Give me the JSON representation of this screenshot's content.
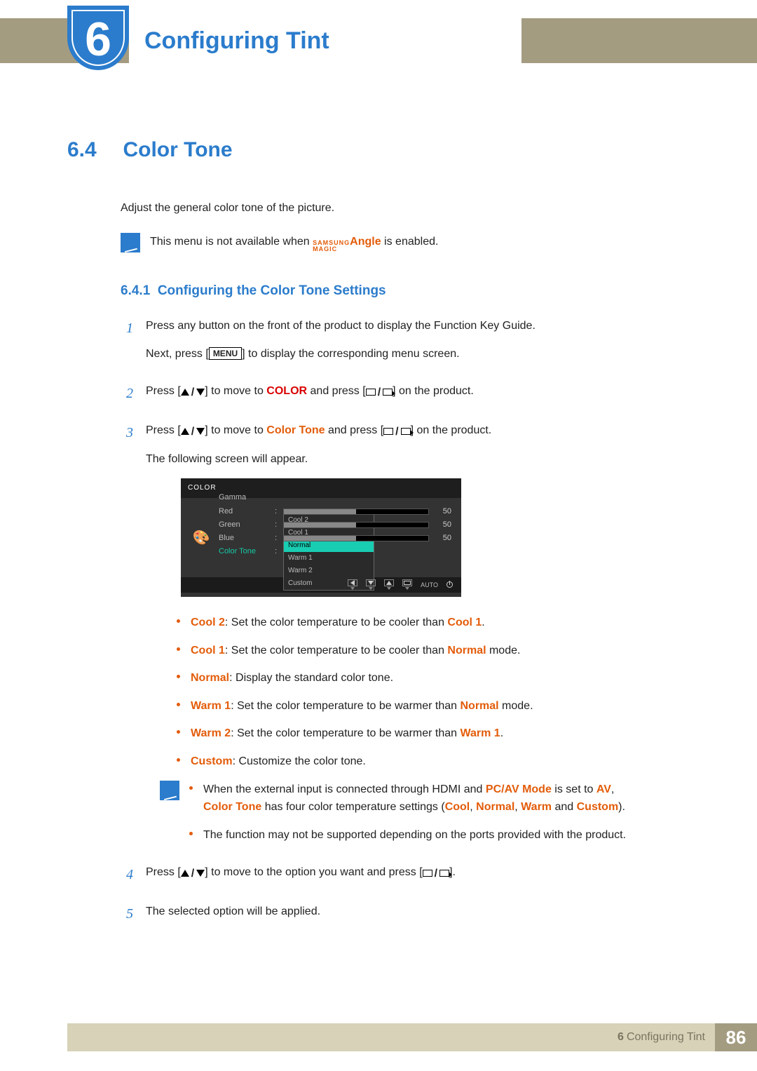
{
  "chapter": {
    "number": "6",
    "title": "Configuring Tint"
  },
  "section": {
    "number": "6.4",
    "title": "Color Tone",
    "intro": "Adjust the general color tone of the picture.",
    "note_prefix": "This menu is not available when ",
    "note_brand_top": "SAMSUNG",
    "note_brand_bottom": "MAGIC",
    "note_brand_suffix": "Angle",
    "note_suffix": " is enabled."
  },
  "subsection": {
    "number": "6.4.1",
    "title": "Configuring the Color Tone Settings"
  },
  "steps": {
    "s1a": "Press any button on the front of the product to display the Function Key Guide.",
    "s1b_prefix": "Next, press [",
    "s1b_menu": "MENU",
    "s1b_suffix": "] to display the corresponding menu screen.",
    "s2_prefix": "Press [",
    "s2_mid": "] to move to ",
    "s2_target": "COLOR",
    "s2_and": " and press [",
    "s2_end": "] on the product.",
    "s3_prefix": "Press [",
    "s3_mid": "] to move to ",
    "s3_target": "Color Tone",
    "s3_and": " and press [",
    "s3_end": "] on the product.",
    "s3_after": "The following screen will appear.",
    "s4_prefix": "Press [",
    "s4_mid": "] to move to the option you want and press [",
    "s4_end": "].",
    "s5": "The selected option will be applied."
  },
  "osd": {
    "title": "COLOR",
    "rows": [
      {
        "label": "Red",
        "value": "50"
      },
      {
        "label": "Green",
        "value": "50"
      },
      {
        "label": "Blue",
        "value": "50"
      }
    ],
    "color_tone_label": "Color Tone",
    "gamma_label": "Gamma",
    "options": [
      "Cool 2",
      "Cool 1",
      "Normal",
      "Warm 1",
      "Warm 2",
      "Custom"
    ],
    "selected": "Normal",
    "auto": "AUTO"
  },
  "bullets": {
    "b0_k": "Cool 2",
    "b0_t": ": Set the color temperature to be cooler than ",
    "b0_r": "Cool 1",
    "b0_e": ".",
    "b1_k": "Cool 1",
    "b1_t": ": Set the color temperature to be cooler than ",
    "b1_r": "Normal",
    "b1_e": " mode.",
    "b2_k": "Normal",
    "b2_t": ": Display the standard color tone.",
    "b3_k": "Warm 1",
    "b3_t": ": Set the color temperature to be warmer than ",
    "b3_r": "Normal",
    "b3_e": " mode.",
    "b4_k": "Warm 2",
    "b4_t": ": Set the color temperature to be warmer than ",
    "b4_r": "Warm 1",
    "b4_e": ".",
    "b5_k": "Custom",
    "b5_t": ": Customize the color tone."
  },
  "note2": {
    "l1a": "When the external input is connected through HDMI and ",
    "l1b": "PC/AV Mode",
    "l1c": " is set to ",
    "l1d": "AV",
    "l1e": ", ",
    "l2a": "Color Tone",
    "l2b": " has four color temperature settings (",
    "l2c": "Cool",
    "l2d": ", ",
    "l2e": "Normal",
    "l2f": ", ",
    "l2g": "Warm",
    "l2h": " and ",
    "l2i": "Custom",
    "l2j": ").",
    "l3": "The function may not be supported depending on the ports provided with the product."
  },
  "footer": {
    "chapter_num": "6",
    "chapter_title": "Configuring Tint",
    "page": "86"
  }
}
